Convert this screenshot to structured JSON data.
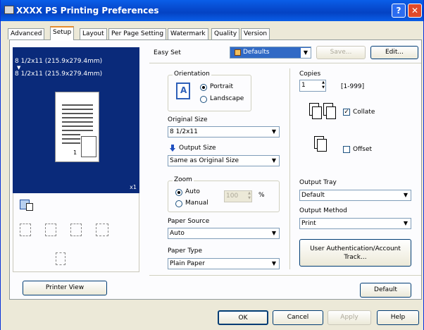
{
  "window": {
    "title": "XXXX PS Printing Preferences"
  },
  "titlebar": {
    "help_glyph": "?",
    "close_glyph": "✕"
  },
  "tabs": [
    "Advanced",
    "Setup",
    "Layout",
    "Per Page Setting",
    "Watermark",
    "Quality",
    "Version"
  ],
  "preview": {
    "line1": "8 1/2x11 (215.9x279.4mm)",
    "arrow": "▼",
    "line2": "8 1/2x11 (215.9x279.4mm)",
    "copies_mark": "x1",
    "page_number": "1",
    "printer_view_label": "Printer View"
  },
  "easy_set": {
    "label": "Easy Set",
    "value": "Defaults",
    "save_label": "Save...",
    "edit_label": "Edit..."
  },
  "orientation": {
    "group_label": "Orientation",
    "portrait": "Portrait",
    "landscape": "Landscape",
    "icon_letter": "A"
  },
  "original_size": {
    "label": "Original Size",
    "value": "8 1/2x11"
  },
  "output_size": {
    "label": "Output Size",
    "value": "Same as Original Size"
  },
  "zoom": {
    "group_label": "Zoom",
    "auto": "Auto",
    "manual": "Manual",
    "value": "100",
    "unit": "%"
  },
  "paper_source": {
    "label": "Paper Source",
    "value": "Auto"
  },
  "paper_type": {
    "label": "Paper Type",
    "value": "Plain Paper"
  },
  "copies": {
    "label": "Copies",
    "value": "1",
    "range": "[1-999]"
  },
  "collate": {
    "label": "Collate",
    "checked": true,
    "check_glyph": "✓"
  },
  "offset": {
    "label": "Offset",
    "checked": false
  },
  "output_tray": {
    "label": "Output Tray",
    "value": "Default"
  },
  "output_method": {
    "label": "Output Method",
    "value": "Print"
  },
  "user_auth": {
    "line1": "User Authentication/Account",
    "line2": "Track..."
  },
  "default_button": "Default",
  "footer": {
    "ok": "OK",
    "cancel": "Cancel",
    "apply": "Apply",
    "help": "Help"
  },
  "dropdown_arrow": "▼",
  "spin_up": "▲",
  "spin_down": "▼"
}
